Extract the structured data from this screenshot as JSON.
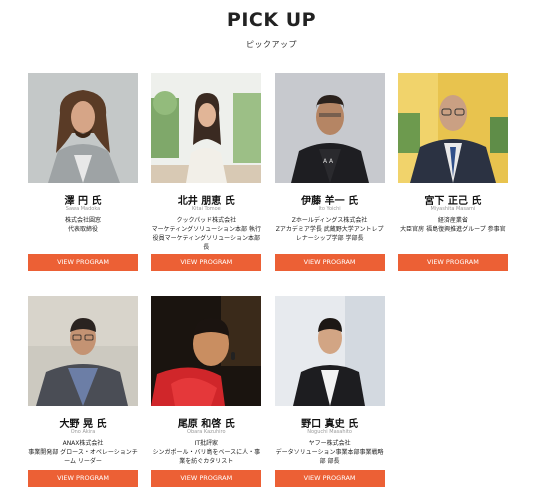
{
  "header": {
    "title": "PICK UP",
    "subtitle": "ピックアップ"
  },
  "button_label": "VIEW PROGRAM",
  "accent_color": "#ec6035",
  "speakers": [
    {
      "name": "澤 円 氏",
      "romaji": "Sawa Madoka",
      "desc": "株式会社圓窓\n代表取締役"
    },
    {
      "name": "北井 朋恵 氏",
      "romaji": "Kitai Tomoe",
      "desc": "クックパッド株式会社\nマーケティングソリューション本部 執行\n役員マーケティングソリューション本部\n長"
    },
    {
      "name": "伊藤 羊一 氏",
      "romaji": "Ito Yoichi",
      "desc": "Zホールディングス株式会社\nZアカデミア学長 武蔵野大学アントレプ\nレナーシップ学部 学部長"
    },
    {
      "name": "宮下 正己 氏",
      "romaji": "Miyashita Masami",
      "desc": "経済産業省\n大臣官房 福島復興推進グループ 参事官"
    },
    {
      "name": "大野 晃 氏",
      "romaji": "Ono Akira",
      "desc": "ANAX株式会社\n事業開発部 グロース・オペレーションチ\nーム リーダー"
    },
    {
      "name": "尾原 和啓 氏",
      "romaji": "Obara Kazuhiro",
      "desc": "IT批評家\nシンガポール・バリ島をベースに人・事\n業を紡ぐカタリスト"
    },
    {
      "name": "野口 真史 氏",
      "romaji": "Noguchi Masahito",
      "desc": "ヤフー株式会社\nデータソリューション事業本部事業戦略\n部 部長"
    }
  ]
}
